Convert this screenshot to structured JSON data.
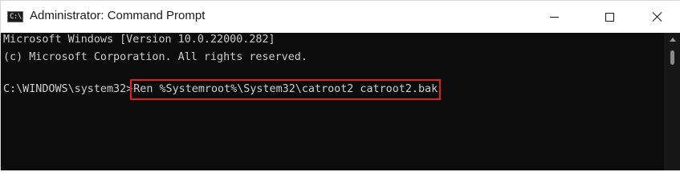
{
  "window": {
    "title": "Administrator: Command Prompt",
    "icon": "cmd-icon",
    "icon_glyph": "C:\\."
  },
  "console": {
    "lines": [
      "Microsoft Windows [Version 10.0.22000.282]",
      "(c) Microsoft Corporation. All rights reserved."
    ],
    "prompt": "C:\\WINDOWS\\system32>",
    "command": "Ren %Systemroot%\\System32\\catroot2 catroot2.bak"
  },
  "colors": {
    "console_background": "#0c0c0c",
    "console_text": "#cccccc",
    "highlight_border": "#e02020"
  }
}
